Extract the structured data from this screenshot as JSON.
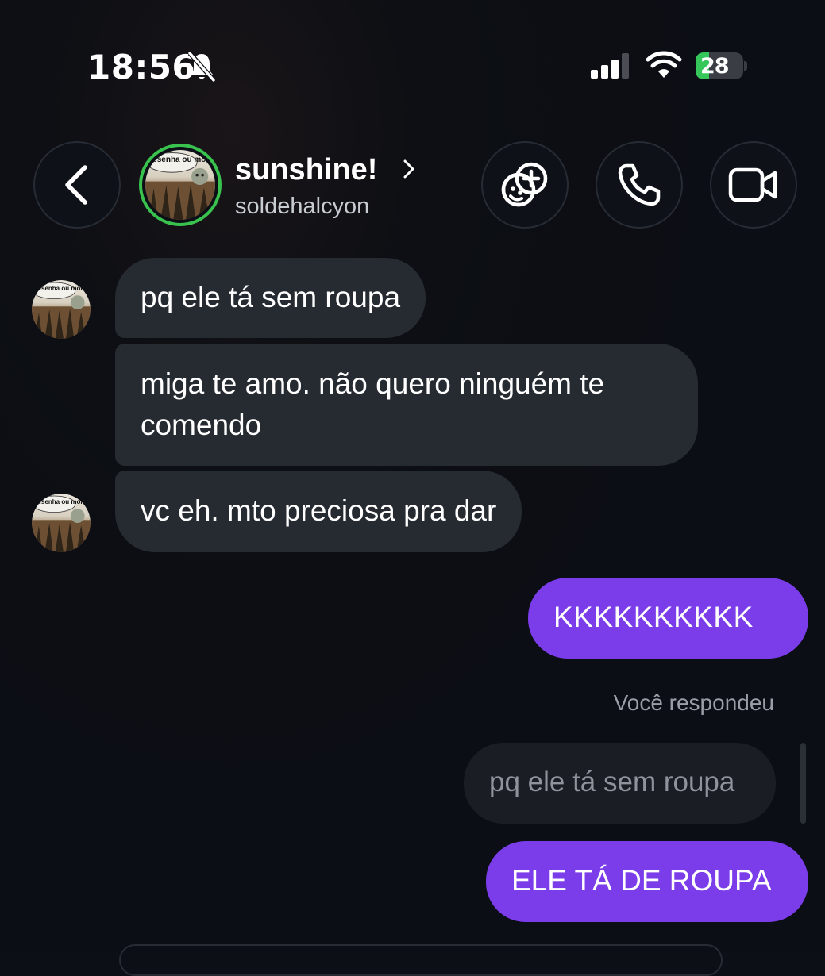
{
  "status_bar": {
    "time": "18:56",
    "battery_percent": "28",
    "battery_level": 0.28,
    "icons": [
      "bell-slash-icon",
      "signal-icon",
      "wifi-icon",
      "battery-charging-icon"
    ]
  },
  "header": {
    "contact_name": "sunshine!",
    "username": "soldehalcyon",
    "avatar_caption": "resenha ou morte",
    "story_ring_color": "#39c24e",
    "buttons": [
      "back-icon",
      "effects-icon",
      "phone-icon",
      "video-icon"
    ]
  },
  "messages": {
    "m1": "pq ele tá sem roupa",
    "m2": "miga te amo. não quero ninguém te comendo",
    "m3": "vc eh. mto preciosa pra dar",
    "m4": "KKKKKKKKKK",
    "reply_label": "Você respondeu",
    "quoted": "pq ele tá sem roupa",
    "m5": "ELE TÁ DE ROUPA"
  },
  "colors": {
    "background": "#0c0f15",
    "incoming_bubble": "#262a31",
    "outgoing_bubble": "#7b3cea",
    "quoted_bubble": "#1a1d23"
  }
}
